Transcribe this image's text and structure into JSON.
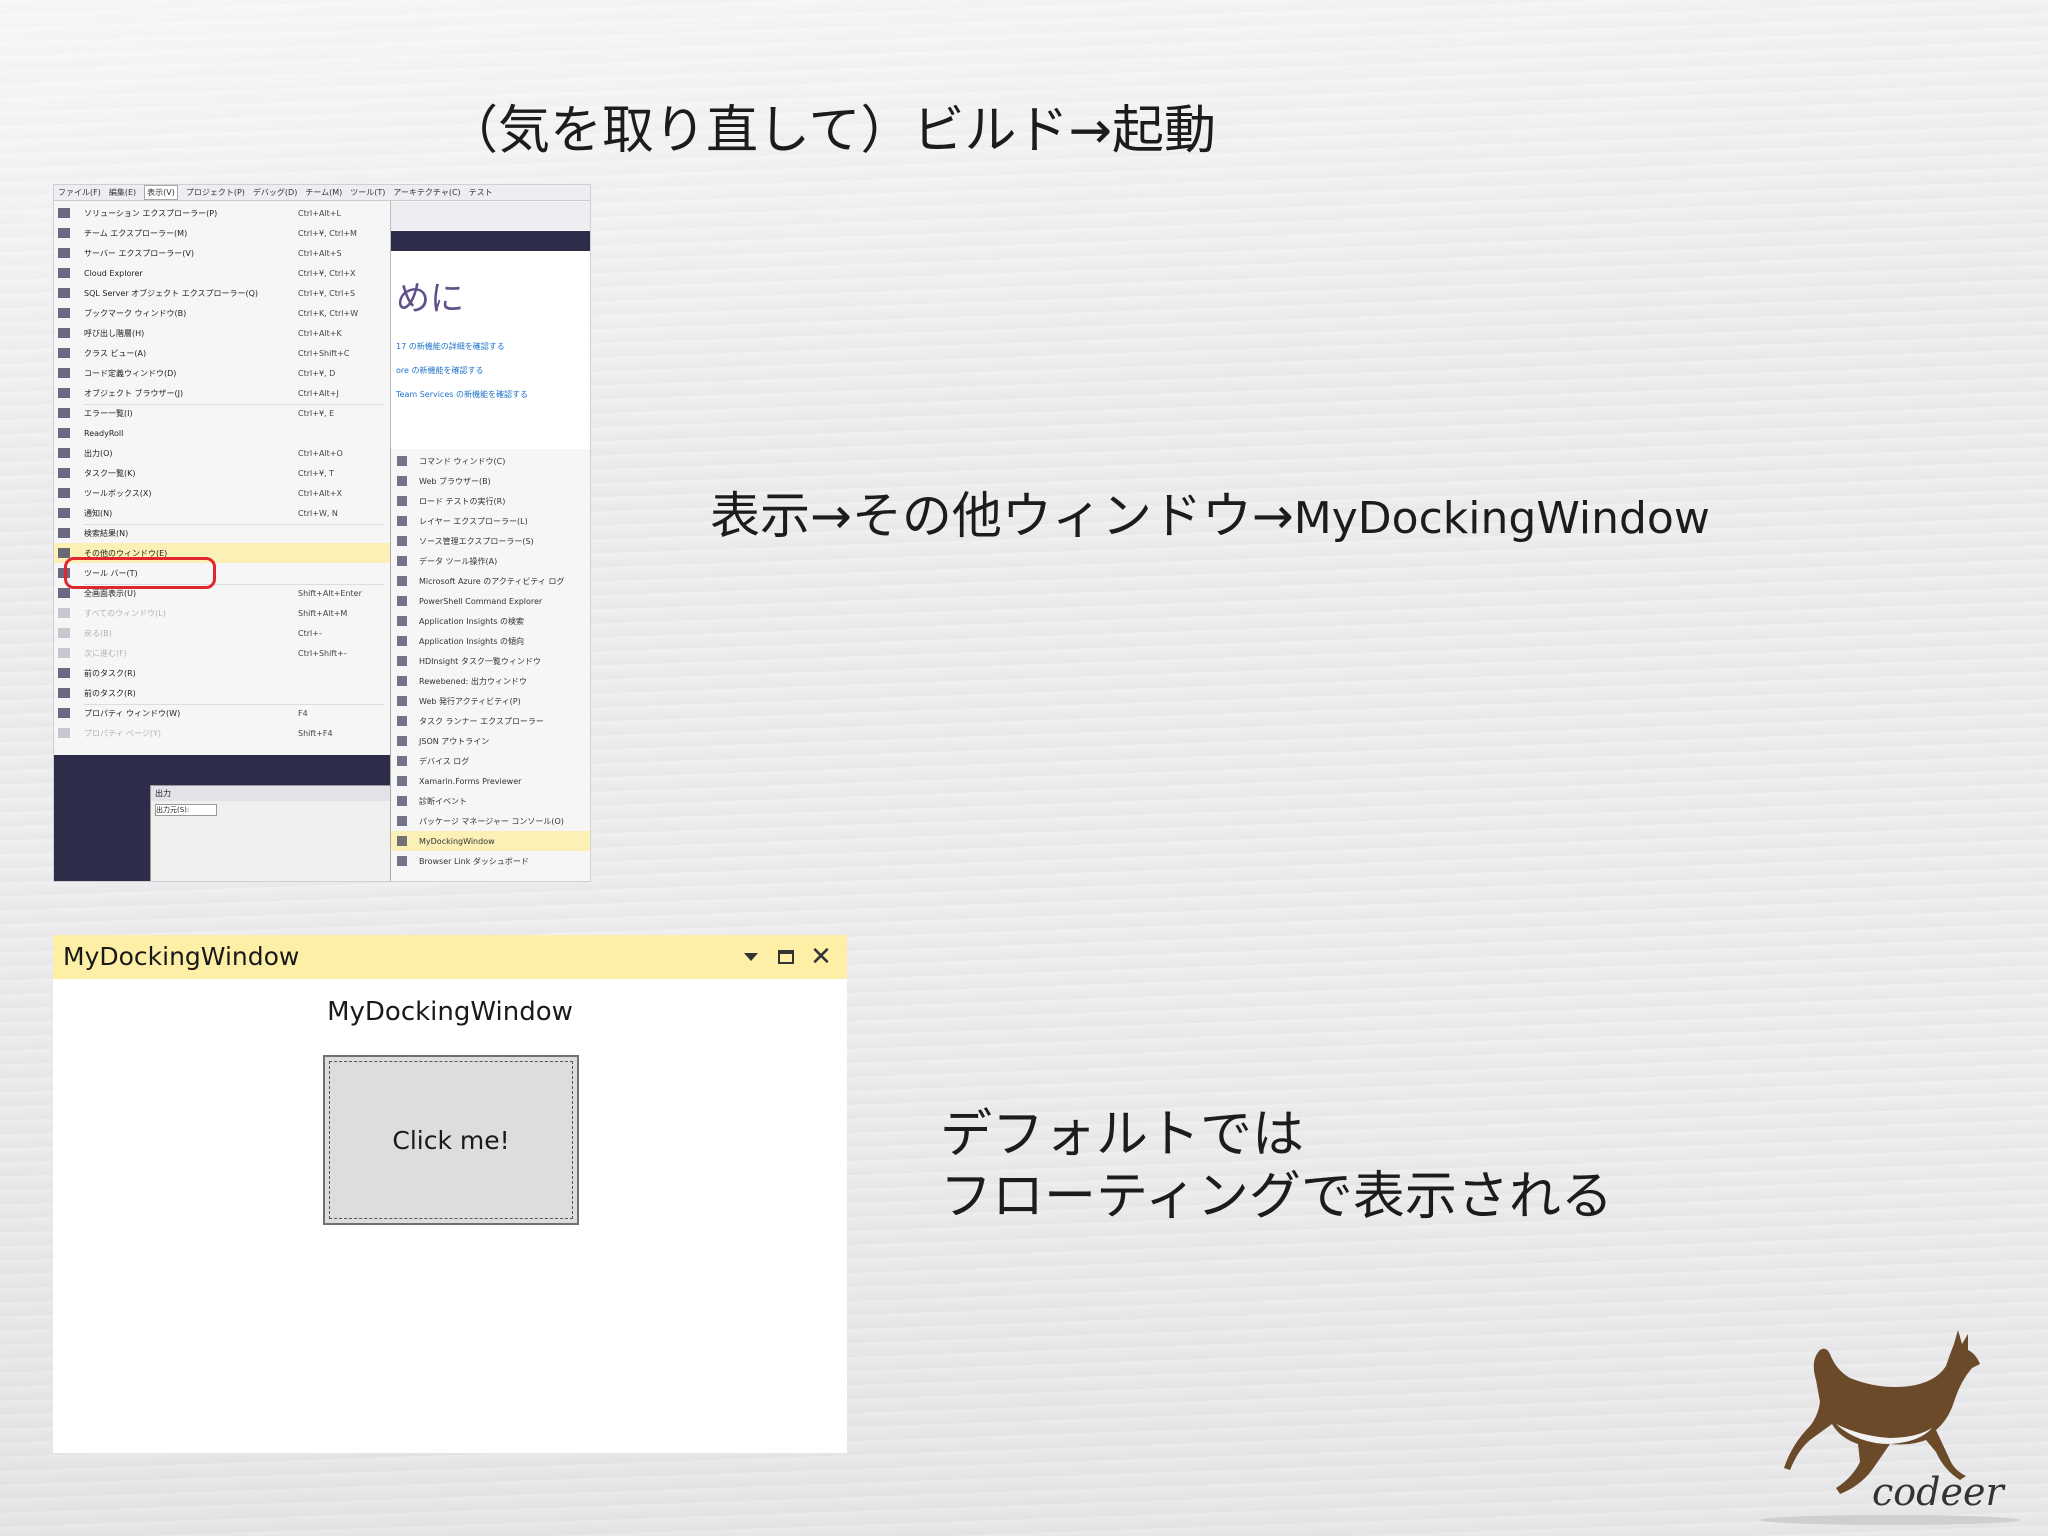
{
  "slide": {
    "title": "（気を取り直して）ビルド→起動",
    "caption1_jp": "表示→その他ウィンドウ→",
    "caption1_en": "MyDockingWindow",
    "caption2_line1": "デフォルトでは",
    "caption2_line2": "フローティングで表示される"
  },
  "vs_menu_screenshot": {
    "menubar": [
      "ファイル(F)",
      "編集(E)",
      "表示(V)",
      "プロジェクト(P)",
      "デバッグ(D)",
      "チーム(M)",
      "ツール(T)",
      "アーキテクチャ(C)",
      "テスト"
    ],
    "active_menu": "表示(V)",
    "start_page_heading": "めに",
    "start_page_links": [
      "17 の新機能の詳細を確認する",
      "ore の新機能を確認する",
      "Team Services の新機能を確認する"
    ],
    "view_menu_items": [
      {
        "label": "ソリューション エクスプローラー(P)",
        "shortcut": "Ctrl+Alt+L"
      },
      {
        "label": "チーム エクスプローラー(M)",
        "shortcut": "Ctrl+¥, Ctrl+M"
      },
      {
        "label": "サーバー エクスプローラー(V)",
        "shortcut": "Ctrl+Alt+S"
      },
      {
        "label": "Cloud Explorer",
        "shortcut": "Ctrl+¥, Ctrl+X"
      },
      {
        "label": "SQL Server オブジェクト エクスプローラー(Q)",
        "shortcut": "Ctrl+¥, Ctrl+S"
      },
      {
        "label": "ブックマーク ウィンドウ(B)",
        "shortcut": "Ctrl+K, Ctrl+W"
      },
      {
        "label": "呼び出し階層(H)",
        "shortcut": "Ctrl+Alt+K"
      },
      {
        "label": "クラス ビュー(A)",
        "shortcut": "Ctrl+Shift+C"
      },
      {
        "label": "コード定義ウィンドウ(D)",
        "shortcut": "Ctrl+¥, D"
      },
      {
        "label": "オブジェクト ブラウザー(J)",
        "shortcut": "Ctrl+Alt+J"
      },
      {
        "label": "エラー一覧(I)",
        "shortcut": "Ctrl+¥, E"
      },
      {
        "label": "ReadyRoll",
        "shortcut": ""
      },
      {
        "label": "出力(O)",
        "shortcut": "Ctrl+Alt+O"
      },
      {
        "label": "タスク一覧(K)",
        "shortcut": "Ctrl+¥, T"
      },
      {
        "label": "ツールボックス(X)",
        "shortcut": "Ctrl+Alt+X"
      },
      {
        "label": "通知(N)",
        "shortcut": "Ctrl+W, N"
      },
      {
        "label": "検索結果(N)",
        "shortcut": ""
      },
      {
        "label": "その他のウィンドウ(E)",
        "shortcut": ""
      },
      {
        "label": "ツール バー(T)",
        "shortcut": ""
      },
      {
        "label": "全画面表示(U)",
        "shortcut": "Shift+Alt+Enter"
      },
      {
        "label": "すべてのウィンドウ(L)",
        "shortcut": "Shift+Alt+M"
      },
      {
        "label": "戻る(B)",
        "shortcut": "Ctrl+-"
      },
      {
        "label": "次に進む(F)",
        "shortcut": "Ctrl+Shift+-"
      },
      {
        "label": "前のタスク(R)",
        "shortcut": ""
      },
      {
        "label": "前のタスク(R)",
        "shortcut": ""
      },
      {
        "label": "プロパティ ウィンドウ(W)",
        "shortcut": "F4"
      },
      {
        "label": "プロパティ ページ(Y)",
        "shortcut": "Shift+F4"
      }
    ],
    "other_windows_items": [
      "コマンド ウィンドウ(C)",
      "Web ブラウザー(B)",
      "ロード テストの実行(R)",
      "レイヤー エクスプローラー(L)",
      "ソース管理エクスプローラー(S)",
      "データ ツール操作(A)",
      "Microsoft Azure のアクティビティ ログ",
      "PowerShell Command Explorer",
      "Application Insights の検索",
      "Application Insights の傾向",
      "HDInsight タスク一覧ウィンドウ",
      "Rewebened: 出力ウィンドウ",
      "Web 発行アクティビティ(P)",
      "タスク ランナー エクスプローラー",
      "JSON アウトライン",
      "デバイス ログ",
      "Xamarin.Forms Previewer",
      "診断イベント",
      "パッケージ マネージャー コンソール(O)",
      "MyDockingWindow",
      "Browser Link ダッシュボード"
    ],
    "output_panel_title": "出力",
    "output_source_label": "出力元(S):"
  },
  "tool_window": {
    "title": "MyDockingWindow",
    "dropdown_icon": "chevron-down-icon",
    "maximize_icon": "maximize-icon",
    "close_icon": "close-icon",
    "content_label": "MyDockingWindow",
    "button_label": "Click me!",
    "title_bar_color": "#fdf0a6"
  },
  "logo": {
    "text": "codeer",
    "icon": "deer-logo-icon"
  }
}
